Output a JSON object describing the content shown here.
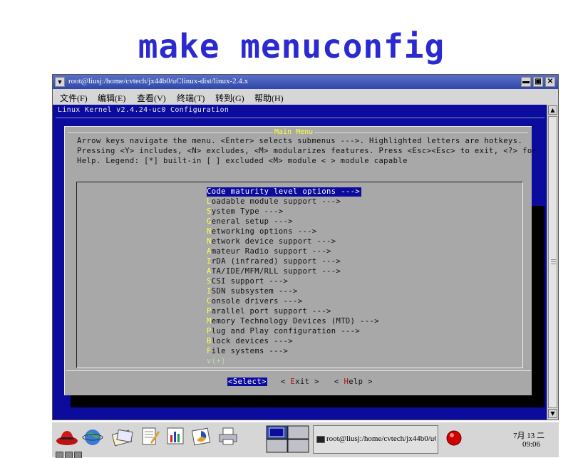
{
  "slide": {
    "title": "make menuconfig"
  },
  "window": {
    "title": "root@liusj:/home/cvtech/jx44b0/uClinux-dist/linux-2.4.x",
    "menu_btn_icon": "chevron-down-icon",
    "controls": {
      "minimize": "▬",
      "maximize": "▣",
      "close": "✕"
    }
  },
  "menubar": {
    "items": [
      {
        "label": "文件(F)"
      },
      {
        "label": "编辑(E)"
      },
      {
        "label": "查看(V)"
      },
      {
        "label": "终端(T)"
      },
      {
        "label": "转到(G)"
      },
      {
        "label": "帮助(H)"
      }
    ]
  },
  "terminal": {
    "header": "Linux Kernel v2.4.24-uc0 Configuration",
    "colors": {
      "background": "#0b0b9e",
      "dialog": "#a8a8a8",
      "hotkey": "#ffff50"
    },
    "dialog": {
      "title": "Main Menu",
      "help_lines": [
        "Arrow keys navigate the menu.  <Enter> selects submenus --->.  Highlighted letters are hotkeys.",
        "Pressing <Y> includes, <N> excludes, <M> modularizes features.  Press <Esc><Esc> to exit, <?> for",
        "Help.  Legend: [*] built-in  [ ] excluded  <M> module  < > module capable"
      ],
      "menu_items": [
        {
          "hotkey": "C",
          "rest": "ode maturity level options  --->"
        },
        {
          "hotkey": "L",
          "rest": "oadable module support  --->"
        },
        {
          "hotkey": "S",
          "rest": "ystem Type  --->"
        },
        {
          "hotkey": "G",
          "rest": "eneral setup  --->"
        },
        {
          "hotkey": "N",
          "rest": "etworking options  --->"
        },
        {
          "hotkey": "N",
          "rest": "etwork device support  --->"
        },
        {
          "hotkey": "A",
          "rest": "mateur Radio support  --->"
        },
        {
          "hotkey": "I",
          "rest": "rDA (infrared) support  --->"
        },
        {
          "hotkey": "A",
          "rest": "TA/IDE/MFM/RLL support  --->"
        },
        {
          "hotkey": "S",
          "rest": "CSI support  --->"
        },
        {
          "hotkey": "I",
          "rest": "SDN subsystem  --->"
        },
        {
          "hotkey": "C",
          "rest": "onsole drivers  --->"
        },
        {
          "hotkey": "P",
          "rest": "arallel port support  --->"
        },
        {
          "hotkey": "M",
          "rest": "emory Technology Devices (MTD)  --->"
        },
        {
          "hotkey": "P",
          "rest": "lug and Play configuration  --->"
        },
        {
          "hotkey": "B",
          "rest": "lock devices  --->"
        },
        {
          "hotkey": "F",
          "rest": "ile systems  --->"
        }
      ],
      "more_indicator": "v(+)",
      "buttons": {
        "select": {
          "lt": "<",
          "hk": "S",
          "rest": "elect>"
        },
        "exit": {
          "lt": "< ",
          "hk": "E",
          "rest": "xit >"
        },
        "help": {
          "lt": "< ",
          "hk": "H",
          "rest": "elp >"
        }
      }
    }
  },
  "scrollbar": {
    "up_icon": "▲",
    "down_icon": "▼"
  },
  "taskbar": {
    "task_label": "root@liusj:/home/cvtech/jx44b0/uC",
    "clock_date": "7月 13 二",
    "clock_time": "09:06"
  }
}
